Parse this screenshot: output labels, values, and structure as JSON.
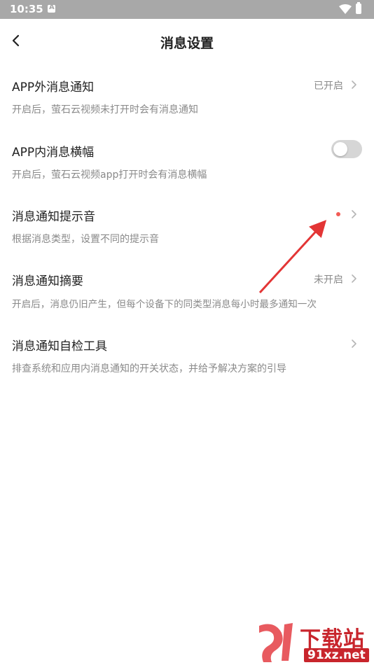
{
  "status_bar": {
    "time": "10:35",
    "notification_icon": "a-notification-icon",
    "wifi_icon": "wifi-icon",
    "battery_icon": "battery-icon"
  },
  "header": {
    "back_icon": "chevron-left-icon",
    "title": "消息设置"
  },
  "settings": [
    {
      "title": "APP外消息通知",
      "desc": "开启后，萤石云视频未打开时会有消息通知",
      "value": "已开启",
      "control": "chevron"
    },
    {
      "title": "APP内消息横幅",
      "desc": "开启后，萤石云视频app打开时会有消息横幅",
      "control": "toggle",
      "toggle_on": false
    },
    {
      "title": "消息通知提示音",
      "desc": "根据消息类型，设置不同的提示音",
      "control": "chevron",
      "badge": "red-dot"
    },
    {
      "title": "消息通知摘要",
      "desc": "开启后，消息仍旧产生，但每个设备下的同类型消息每小时最多通知一次",
      "value": "未开启",
      "control": "chevron"
    },
    {
      "title": "消息通知自检工具",
      "desc": "排查系统和应用内消息通知的开关状态，并给予解决方案的引导",
      "control": "chevron"
    }
  ],
  "watermark": {
    "main": "下载站",
    "sub": "91xz.net"
  },
  "colors": {
    "status_bar": "#a8a8a8",
    "secondary_text": "#8a8a8a",
    "toggle_off": "#d6d6d6",
    "red_dot": "#f25b55",
    "annotation_arrow": "#e02020",
    "watermark_red": "#c8252c"
  }
}
